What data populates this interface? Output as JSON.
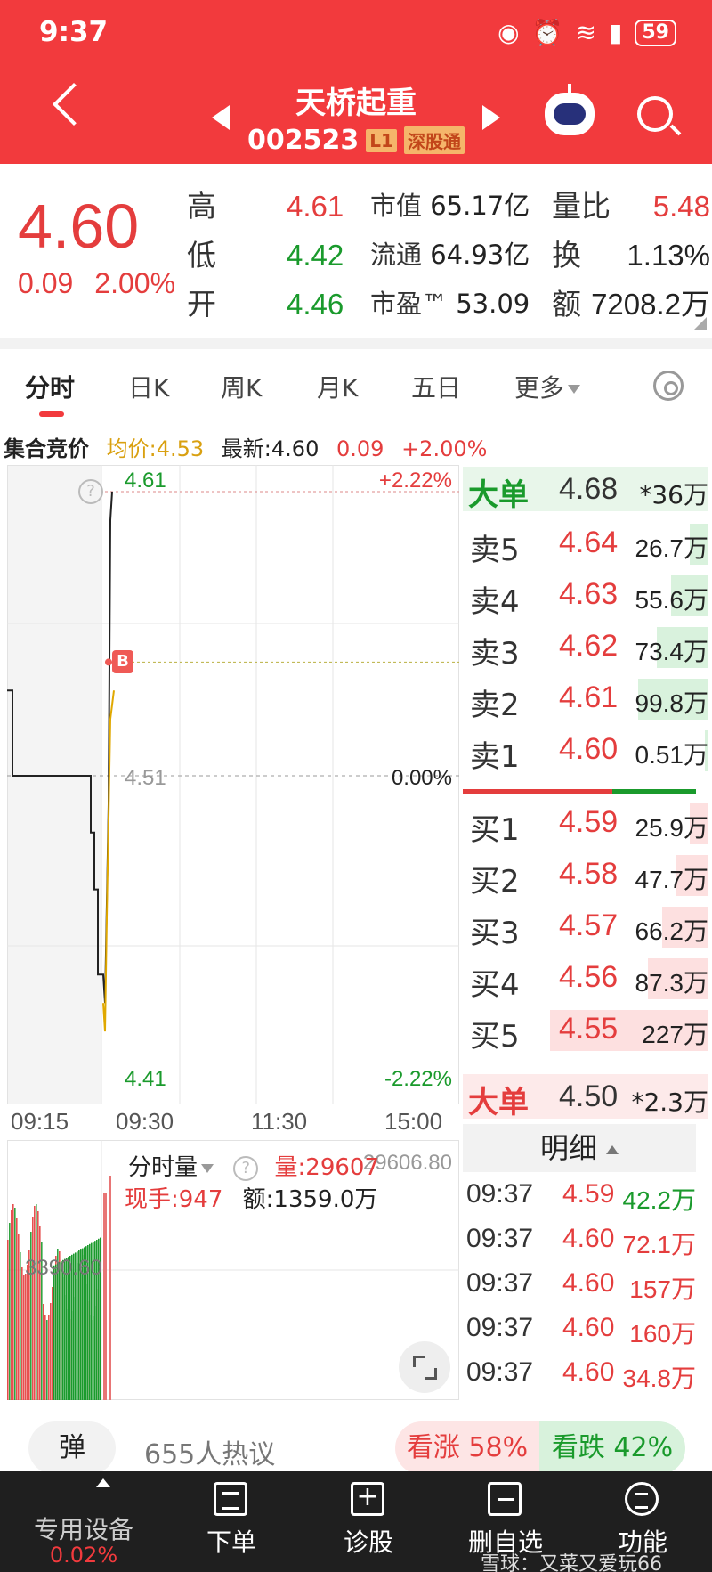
{
  "status_bar": {
    "time": "9:37",
    "battery": "59"
  },
  "header": {
    "title": "天桥起重",
    "code": "002523",
    "tag_l1": "L1",
    "tag_market": "深股通"
  },
  "quote": {
    "price": "4.60",
    "change": "0.09",
    "change_pct": "2.00%",
    "high_label": "高",
    "high": "4.61",
    "low_label": "低",
    "low": "4.42",
    "open_label": "开",
    "open": "4.46",
    "mcap_label": "市值",
    "mcap": "65.17亿",
    "float_label": "流通",
    "float": "64.93亿",
    "pe_label": "市盈™",
    "pe": "53.09",
    "vol_ratio_label": "量比",
    "vol_ratio": "5.48",
    "turnover_label": "换",
    "turnover": "1.13%",
    "amount_label": "额",
    "amount": "7208.2万"
  },
  "tabs": [
    "分时",
    "日K",
    "周K",
    "月K",
    "五日",
    "更多"
  ],
  "info_line": {
    "auction": "集合竞价",
    "avg": "均价:4.53",
    "latest": "最新:4.60",
    "chg": "0.09",
    "pct": "+2.00%"
  },
  "chart_data": {
    "type": "line",
    "ylim": [
      4.41,
      4.61
    ],
    "y_ticks": {
      "top": "4.61",
      "mid": "4.51",
      "bottom": "4.41"
    },
    "pct_ticks": {
      "top": "+2.22%",
      "mid": "0.00%",
      "bottom": "-2.22%"
    },
    "x_ticks": [
      "09:15",
      "09:30",
      "11:30",
      "15:00"
    ],
    "marker": "B",
    "marker_price": 4.55
  },
  "volume": {
    "selector": "分时量",
    "vol": "量:29607",
    "hand": "现手:947",
    "amount": "额:1359.0万",
    "max_label": "29606.80",
    "mid_label": "3390.60"
  },
  "orderbook": {
    "big_sell": {
      "label": "大单",
      "price": "4.68",
      "vol": "*36万"
    },
    "sells": [
      {
        "label": "卖5",
        "price": "4.64",
        "vol": "26.7万",
        "ratio": 0.08
      },
      {
        "label": "卖4",
        "price": "4.63",
        "vol": "55.6万",
        "ratio": 0.16
      },
      {
        "label": "卖3",
        "price": "4.62",
        "vol": "73.4万",
        "ratio": 0.22
      },
      {
        "label": "卖2",
        "price": "4.61",
        "vol": "99.8万",
        "ratio": 0.3
      },
      {
        "label": "卖1",
        "price": "4.60",
        "vol": "0.51万",
        "ratio": 0.0
      }
    ],
    "buys": [
      {
        "label": "买1",
        "price": "4.59",
        "vol": "25.9万",
        "ratio": 0.08
      },
      {
        "label": "买2",
        "price": "4.58",
        "vol": "47.7万",
        "ratio": 0.14
      },
      {
        "label": "买3",
        "price": "4.57",
        "vol": "66.2万",
        "ratio": 0.2
      },
      {
        "label": "买4",
        "price": "4.56",
        "vol": "87.3万",
        "ratio": 0.26
      },
      {
        "label": "买5",
        "price": "4.55",
        "vol": "227万",
        "ratio": 0.68
      }
    ],
    "big_buy": {
      "label": "大单",
      "price": "4.50",
      "vol": "*2.3万"
    }
  },
  "detail": {
    "title": "明细",
    "rows": [
      {
        "time": "09:37",
        "price": "4.59",
        "vol": "42.2万",
        "dir": "green"
      },
      {
        "time": "09:37",
        "price": "4.60",
        "vol": "72.1万",
        "dir": "red"
      },
      {
        "time": "09:37",
        "price": "4.60",
        "vol": "157万",
        "dir": "red"
      },
      {
        "time": "09:37",
        "price": "4.60",
        "vol": "160万",
        "dir": "red"
      },
      {
        "time": "09:37",
        "price": "4.60",
        "vol": "34.8万",
        "dir": "red"
      }
    ]
  },
  "hot": {
    "bullet": "弹",
    "people": "655人热议",
    "bull": "看涨 58%",
    "bear": "看跌 42%"
  },
  "bottom_nav": {
    "device": "专用设备",
    "device_pct": "0.02%",
    "order": "下单",
    "diag": "诊股",
    "remove": "删自选",
    "func": "功能"
  },
  "watermark": "雪球：又菜又爱玩66"
}
